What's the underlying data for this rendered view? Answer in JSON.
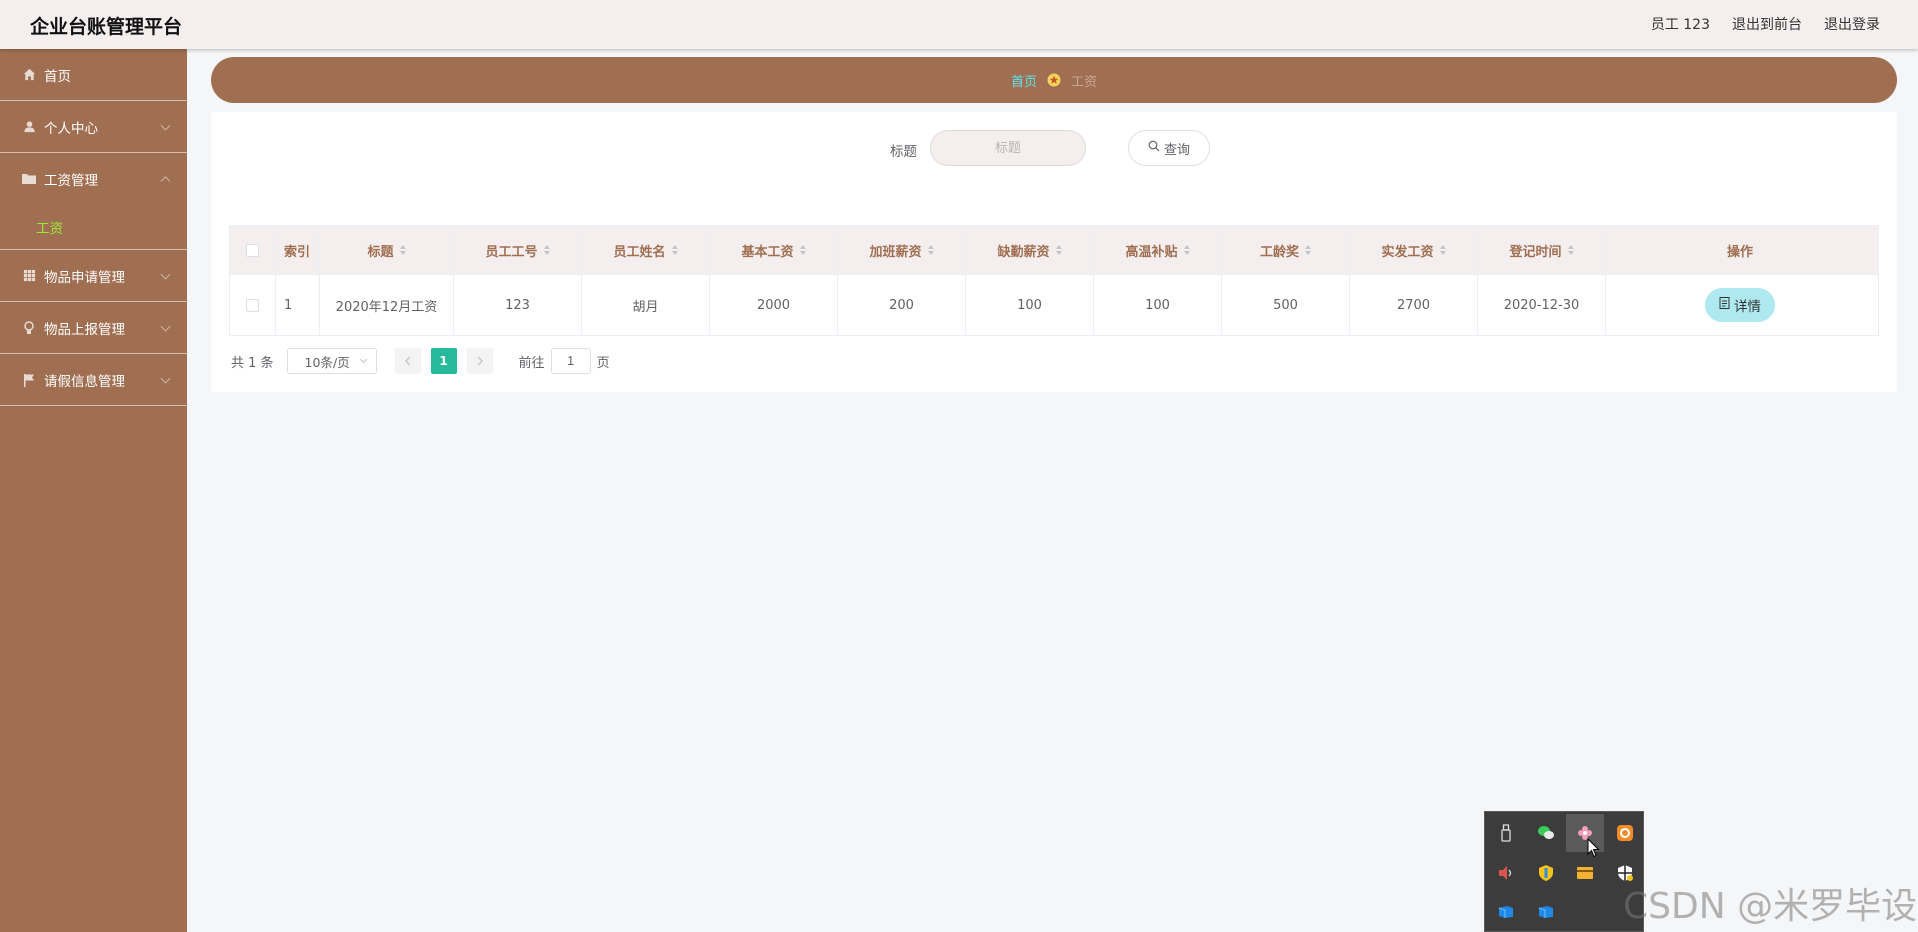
{
  "header": {
    "app_title": "企业台账管理平台",
    "user_label": "员工 123",
    "front_link": "退出到前台",
    "logout_link": "退出登录"
  },
  "sidebar": {
    "items": [
      {
        "label": "首页",
        "icon": "home-icon"
      },
      {
        "label": "个人中心",
        "icon": "user-icon"
      },
      {
        "label": "工资管理",
        "icon": "folder-icon",
        "sub": [
          {
            "label": "工资"
          }
        ]
      },
      {
        "label": "物品申请管理",
        "icon": "grid-icon"
      },
      {
        "label": "物品上报管理",
        "icon": "lightbulb-icon"
      },
      {
        "label": "请假信息管理",
        "icon": "flag-icon"
      }
    ]
  },
  "breadcrumb": {
    "home": "首页",
    "current": "工资"
  },
  "search": {
    "label": "标题",
    "placeholder": "标题",
    "button": "查询"
  },
  "table": {
    "columns": [
      "索引",
      "标题",
      "员工工号",
      "员工姓名",
      "基本工资",
      "加班薪资",
      "缺勤薪资",
      "高温补贴",
      "工龄奖",
      "实发工资",
      "登记时间",
      "操作"
    ],
    "rows": [
      {
        "index": "1",
        "title": "2020年12月工资",
        "emp_no": "123",
        "name": "胡月",
        "base": "2000",
        "overtime": "200",
        "absence": "100",
        "heat": "100",
        "seniority": "500",
        "actual": "2700",
        "date": "2020-12-30",
        "action": "详情"
      }
    ]
  },
  "pagination": {
    "total": "共 1 条",
    "page_size": "10条/页",
    "current_page": "1",
    "goto_prefix": "前往",
    "goto_value": "1",
    "goto_suffix": "页"
  },
  "watermark": "CSDN @米罗毕设",
  "colors": {
    "sidebar": "#a06f52",
    "accent": "#26b99a",
    "detail_btn": "#aee9ef",
    "crumb_home": "#5be6f0",
    "submenu_active": "#9fe53a"
  }
}
